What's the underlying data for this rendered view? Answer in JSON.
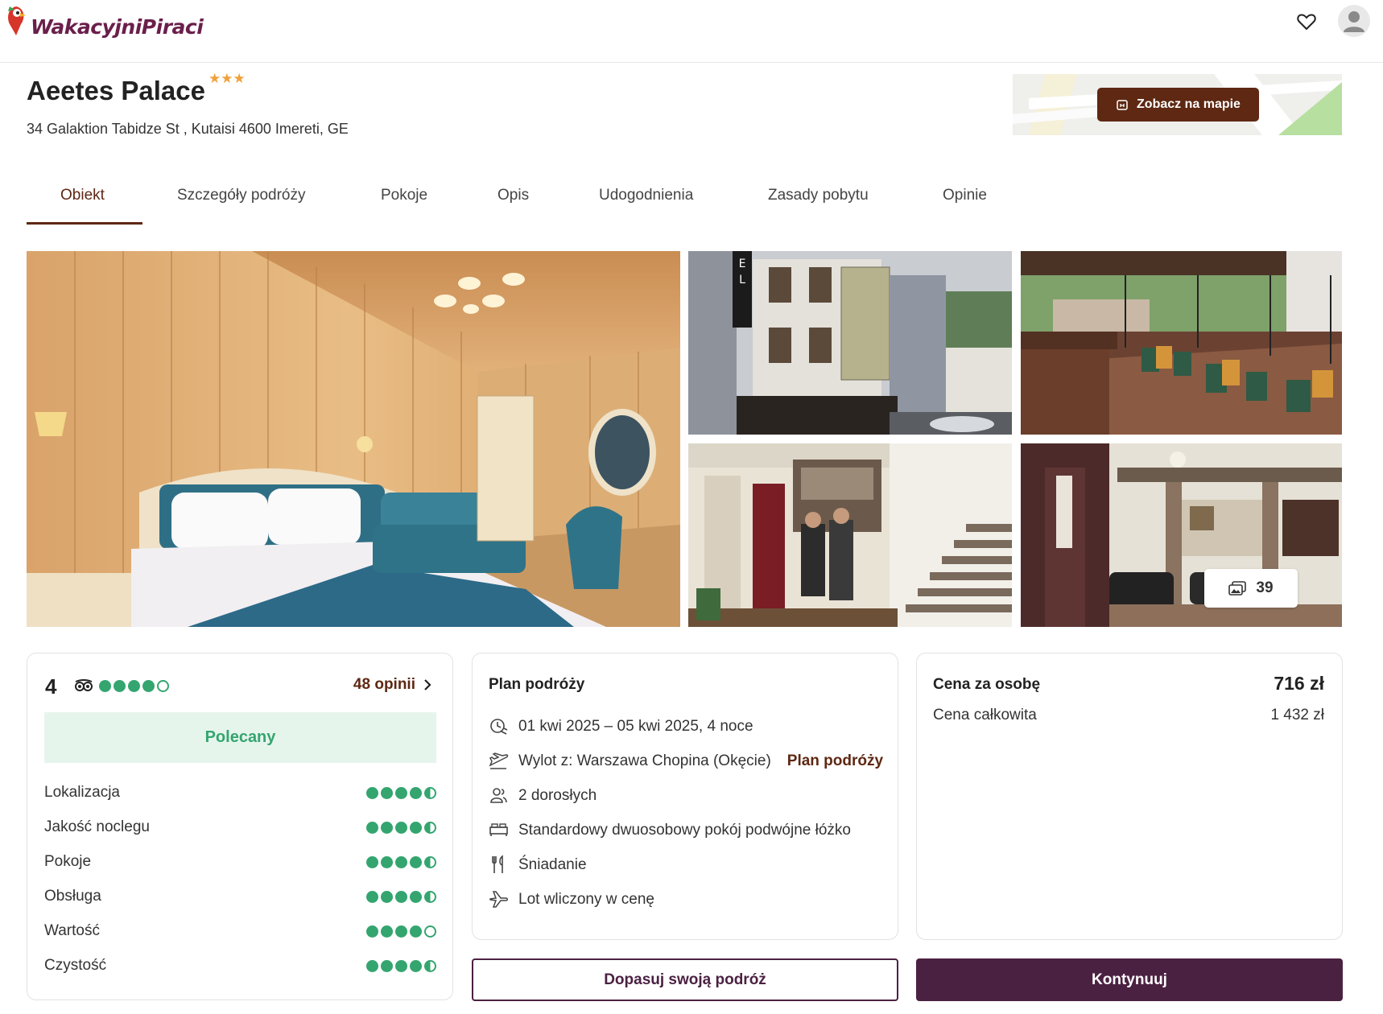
{
  "header": {
    "logo_text": "WakacyjniPiraci"
  },
  "hotel": {
    "name": "Aeetes Palace",
    "stars": "★★★",
    "address": "34 Galaktion Tabidze St , Kutaisi 4600 Imereti, GE",
    "map_button": "Zobacz na mapie"
  },
  "tabs": [
    {
      "label": "Obiekt"
    },
    {
      "label": "Szczegóły podróży"
    },
    {
      "label": "Pokoje"
    },
    {
      "label": "Opis"
    },
    {
      "label": "Udogodnienia"
    },
    {
      "label": "Zasady pobytu"
    },
    {
      "label": "Opinie"
    }
  ],
  "gallery": {
    "photo_count": "39"
  },
  "rating": {
    "score": "4",
    "opinions": "48 opinii",
    "badge": "Polecany",
    "overall_dots": 4,
    "criteria": [
      {
        "label": "Lokalizacja",
        "score": 4.5
      },
      {
        "label": "Jakość noclegu",
        "score": 4.5
      },
      {
        "label": "Pokoje",
        "score": 4.5
      },
      {
        "label": "Obsługa",
        "score": 4.5
      },
      {
        "label": "Wartość",
        "score": 4
      },
      {
        "label": "Czystość",
        "score": 4.5
      }
    ]
  },
  "plan": {
    "title": "Plan podróży",
    "dates": "01 kwi 2025 – 05 kwi 2025, 4 noce",
    "departure": "Wylot z: Warszawa Chopina (Okęcie)",
    "departure_link": "Plan podróży",
    "guests": "2 dorosłych",
    "room": "Standardowy dwuosobowy pokój podwójne łóżko",
    "board": "Śniadanie",
    "flight": "Lot wliczony w cenę"
  },
  "price": {
    "per_person_label": "Cena za osobę",
    "per_person_value": "716 zł",
    "total_label": "Cena całkowita",
    "total_value": "1 432 zł"
  },
  "actions": {
    "adjust": "Dopasuj swoją podróż",
    "continue": "Kontynuuj"
  },
  "colors": {
    "brand": "#5e2813",
    "primary": "#4b2142",
    "rating_green": "#34a56f",
    "stars": "#f0a13a"
  }
}
